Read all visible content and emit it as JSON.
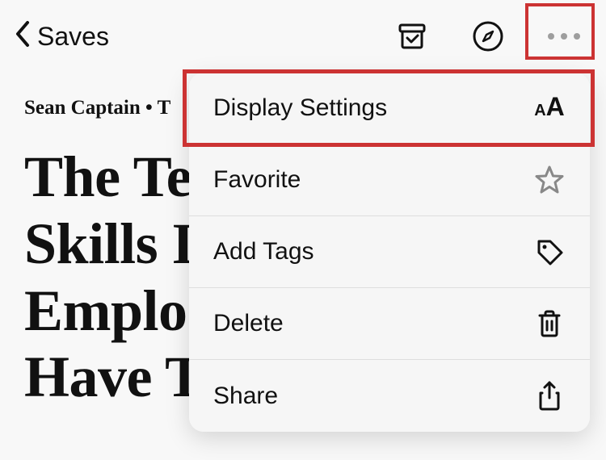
{
  "header": {
    "back_label": "Saves"
  },
  "article": {
    "byline": "Sean Captain • T",
    "headline": "The Te\nSkills I\nEmplo\nHave T"
  },
  "menu": {
    "items": [
      {
        "label": "Display Settings",
        "icon": "text-size-icon"
      },
      {
        "label": "Favorite",
        "icon": "star-icon"
      },
      {
        "label": "Add Tags",
        "icon": "tag-icon"
      },
      {
        "label": "Delete",
        "icon": "trash-icon"
      },
      {
        "label": "Share",
        "icon": "share-icon"
      }
    ]
  }
}
